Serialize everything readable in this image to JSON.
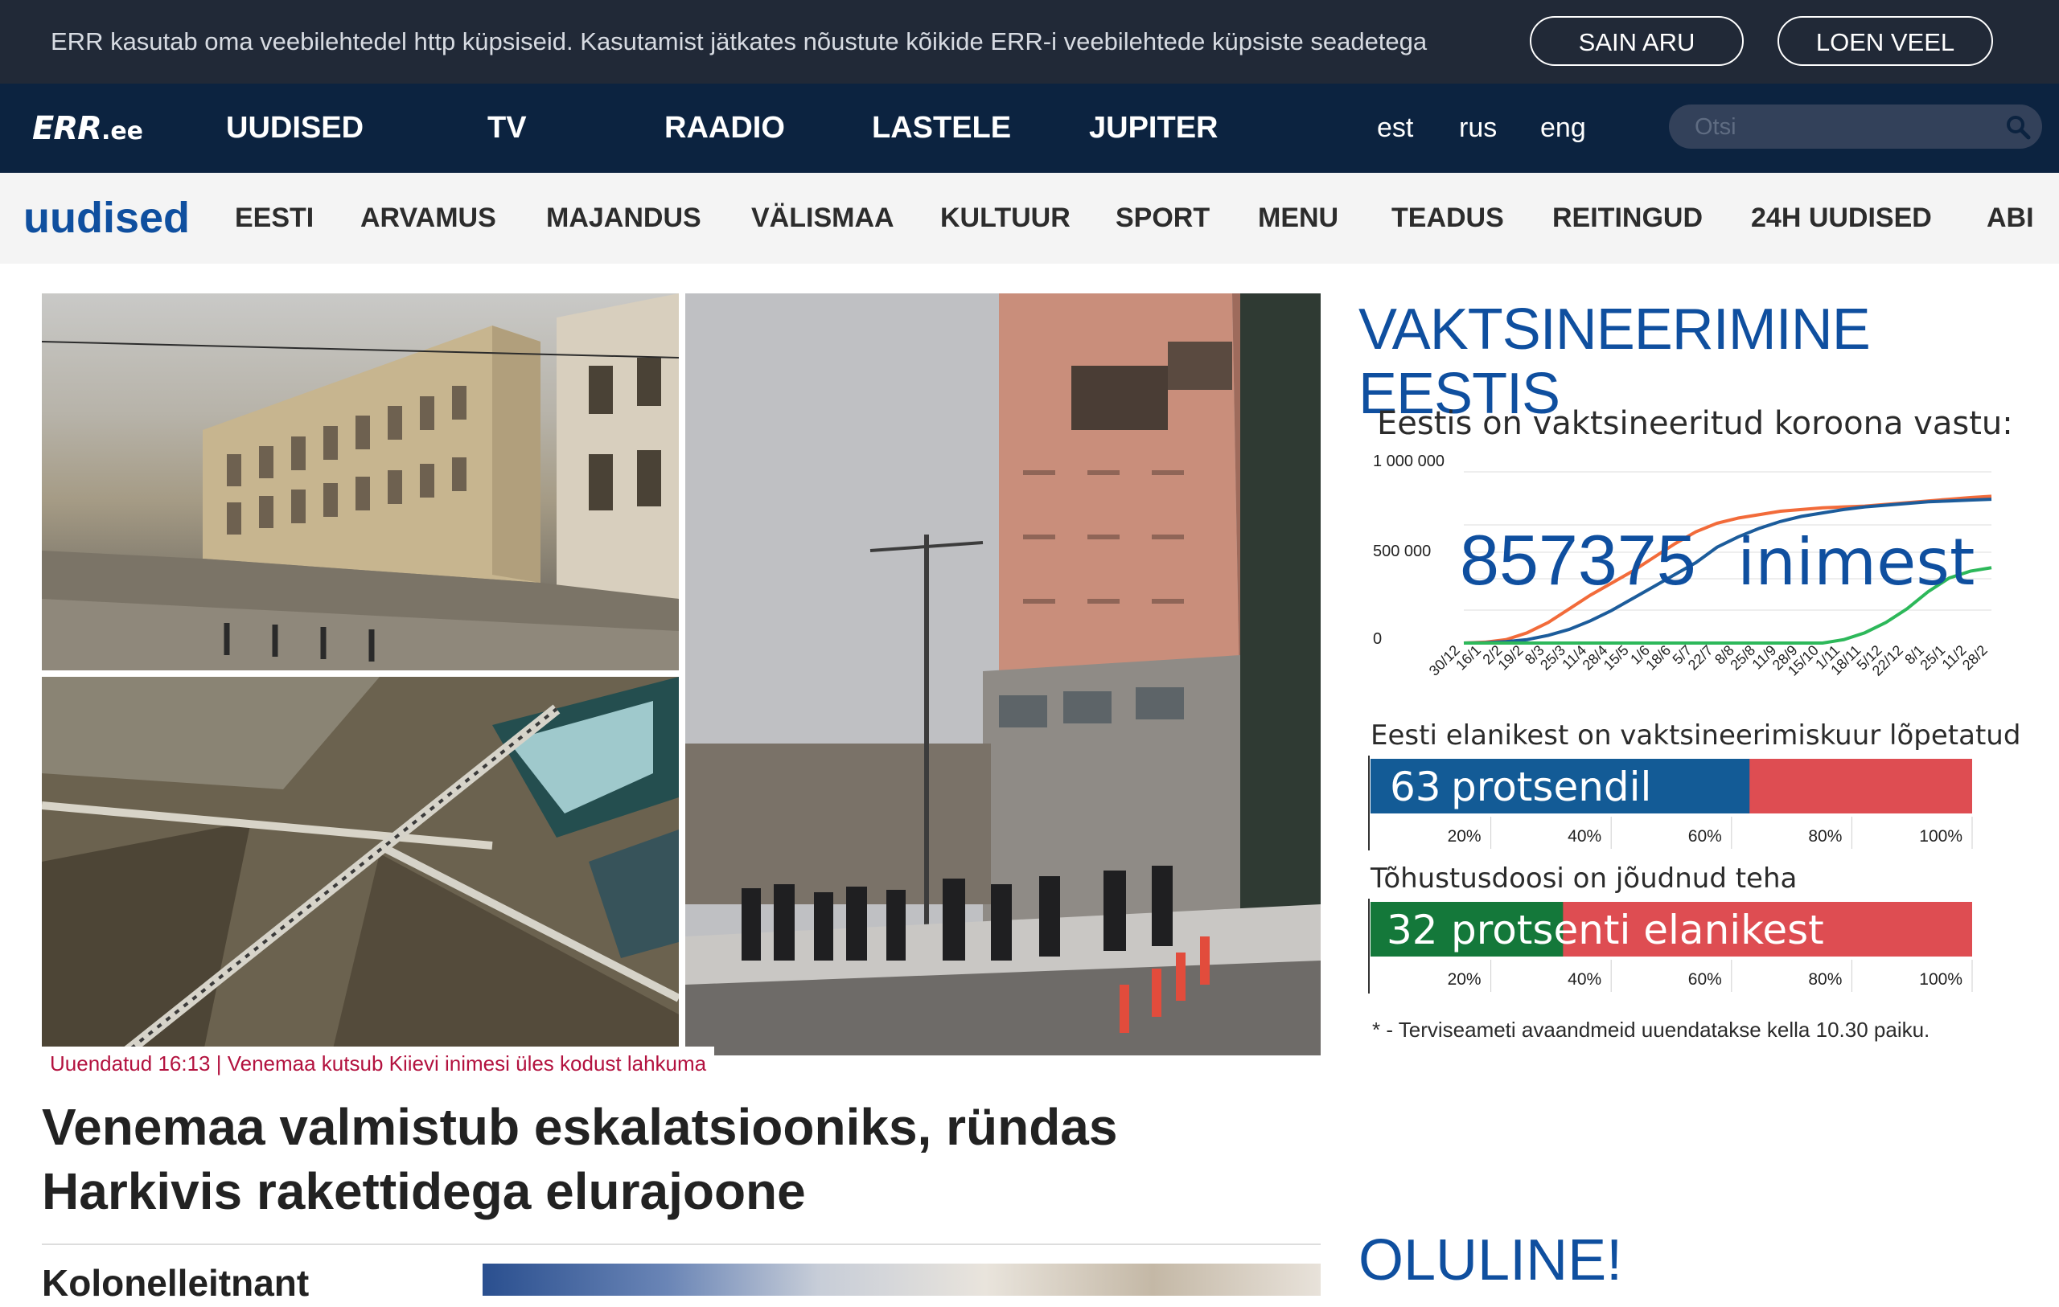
{
  "cookie": {
    "text": "ERR kasutab oma veebilehtedel http küpsiseid. Kasutamist jätkates nõustute kõikide ERR-i veebilehtede küpsiste seadetega",
    "accept_label": "SAIN ARU",
    "more_label": "LOEN VEEL"
  },
  "header": {
    "logo": "ERR",
    "logo_suffix": ".ee",
    "nav": [
      "UUDISED",
      "TV",
      "RAADIO",
      "LASTELE",
      "JUPITER"
    ],
    "languages": [
      "est",
      "rus",
      "eng"
    ],
    "search_placeholder": "Otsi"
  },
  "subnav": {
    "brand": "uudised",
    "items": [
      "EESTI",
      "ARVAMUS",
      "MAJANDUS",
      "VÄLISMAA",
      "KULTUUR",
      "SPORT",
      "MENU",
      "TEADUS",
      "REITINGUD",
      "24H UUDISED",
      "ABI"
    ]
  },
  "main": {
    "tag": "Uuendatud 16:13 | Venemaa kutsub Kiievi inimesi üles kodust lahkuma",
    "headline": "Venemaa valmistub eskalatsiooniks, ründas Harkivis rakettidega elurajoone",
    "next_headline": "Kolonelleitnant"
  },
  "sidebar": {
    "title": "VAKTSINEERIMINE EESTIS",
    "vaccinated_caption": "Eestis on vaktsineeritud koroona vastu:",
    "vaccinated_count": "857375",
    "vaccinated_unit": "inimest",
    "completed_caption": "Eesti elanikest on vaktsineerimiskuur lõpetatud",
    "completed_value": "63",
    "completed_unit": "protsendil",
    "booster_caption": "Tõhustusdoosi on jõudnud teha",
    "booster_value": "32",
    "booster_unit": "protsenti elanikest",
    "footnote": "* - Terviseameti avaandmeid uuendatakse kella 10.30 paiku.",
    "important_title": "OLULINE!"
  },
  "chart_data": [
    {
      "type": "line",
      "title": "Eestis on vaktsineeritud koroona vastu:",
      "yticks": [
        "1 000 000",
        "500 000",
        "0"
      ],
      "ylim": [
        0,
        1000000
      ],
      "x": [
        "30/12",
        "16/1",
        "2/2",
        "19/2",
        "8/3",
        "25/3",
        "11/4",
        "28/4",
        "15/5",
        "1/6",
        "18/6",
        "5/7",
        "22/7",
        "8/8",
        "25/8",
        "11/9",
        "28/9",
        "15/10",
        "1/11",
        "18/11",
        "5/12",
        "22/12",
        "8/1",
        "25/1",
        "11/2",
        "28/2"
      ],
      "series": [
        {
          "color": "#f26b3a",
          "values": [
            0,
            5000,
            20000,
            60000,
            120000,
            200000,
            280000,
            350000,
            420000,
            500000,
            580000,
            650000,
            700000,
            730000,
            750000,
            770000,
            780000,
            790000,
            795000,
            800000,
            810000,
            820000,
            830000,
            840000,
            850000,
            857375
          ]
        },
        {
          "color": "#1c5c9b",
          "values": [
            0,
            2000,
            8000,
            20000,
            45000,
            80000,
            130000,
            190000,
            260000,
            330000,
            400000,
            470000,
            560000,
            620000,
            670000,
            710000,
            740000,
            760000,
            780000,
            795000,
            805000,
            815000,
            825000,
            830000,
            835000,
            840000
          ]
        },
        {
          "color": "#2db85a",
          "values": [
            0,
            0,
            0,
            0,
            0,
            0,
            0,
            0,
            0,
            0,
            0,
            0,
            0,
            0,
            0,
            0,
            0,
            0,
            20000,
            60000,
            120000,
            200000,
            300000,
            380000,
            420000,
            440000
          ]
        }
      ],
      "overlay_label": "857375 inimest",
      "grid": true
    },
    {
      "type": "bar",
      "title": "Eesti elanikest on vaktsineerimiskuur lõpetatud",
      "xticks": [
        "20%",
        "40%",
        "60%",
        "80%",
        "100%"
      ],
      "values": [
        63
      ],
      "xlim": [
        0,
        100
      ],
      "colors": [
        "#135b96",
        "#de4d52"
      ]
    },
    {
      "type": "bar",
      "title": "Tõhustusdoosi on jõudnud teha",
      "xticks": [
        "20%",
        "40%",
        "60%",
        "80%",
        "100%"
      ],
      "values": [
        32
      ],
      "xlim": [
        0,
        100
      ],
      "colors": [
        "#14783a",
        "#de4d52"
      ]
    }
  ]
}
